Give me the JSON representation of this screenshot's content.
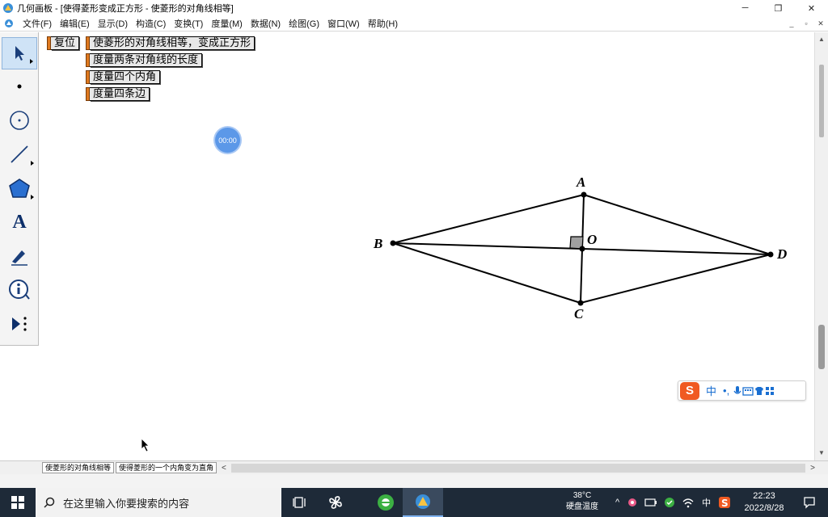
{
  "window": {
    "title": "几何画板 - [使得菱形变成正方形 - 使菱形的对角线相等]",
    "minimize": "─",
    "maximize": "❐",
    "close": "✕"
  },
  "menu": [
    "文件(F)",
    "编辑(E)",
    "显示(D)",
    "构造(C)",
    "变换(T)",
    "度量(M)",
    "数据(N)",
    "绘图(G)",
    "窗口(W)",
    "帮助(H)"
  ],
  "mdi_controls": {
    "minimize": "_",
    "restore": "▫",
    "close": "✕"
  },
  "toolbox": [
    {
      "name": "arrow-tool-icon",
      "selected": true
    },
    {
      "name": "point-tool-icon"
    },
    {
      "name": "compass-tool-icon"
    },
    {
      "name": "straightedge-tool-icon"
    },
    {
      "name": "polygon-tool-icon"
    },
    {
      "name": "text-tool-icon",
      "glyph": "A"
    },
    {
      "name": "marker-tool-icon"
    },
    {
      "name": "information-tool-icon"
    },
    {
      "name": "custom-tool-icon"
    }
  ],
  "action_buttons": {
    "reset": "复位",
    "equal_diagonals": "使菱形的对角线相等，变成正方形",
    "measure_diagonals": "度量两条对角线的长度",
    "measure_angles": "度量四个内角",
    "measure_sides": "度量四条边"
  },
  "timer": "00:00",
  "geometry": {
    "points": [
      {
        "label": "A"
      },
      {
        "label": "B"
      },
      {
        "label": "C"
      },
      {
        "label": "D"
      },
      {
        "label": "O"
      }
    ]
  },
  "page_tabs": [
    "使菱形的对角线相等",
    "使得菱形的一个内角变为直角"
  ],
  "scroll": {
    "left": "<",
    "right": ">",
    "up": "▲",
    "down": "▼"
  },
  "taskbar": {
    "search_placeholder": "在这里输入你要搜索的内容",
    "weather_temp": "38°C",
    "weather_label": "硬盘温度",
    "ime_lang": "中",
    "time": "22:23",
    "date": "2022/8/28"
  },
  "ime_bar": {
    "logo": "S",
    "mode": "中",
    "punct": "•,"
  },
  "colors": {
    "button_tab": "#e07a20",
    "taskbar": "#1e2a38",
    "timer": "#5c98e8"
  }
}
